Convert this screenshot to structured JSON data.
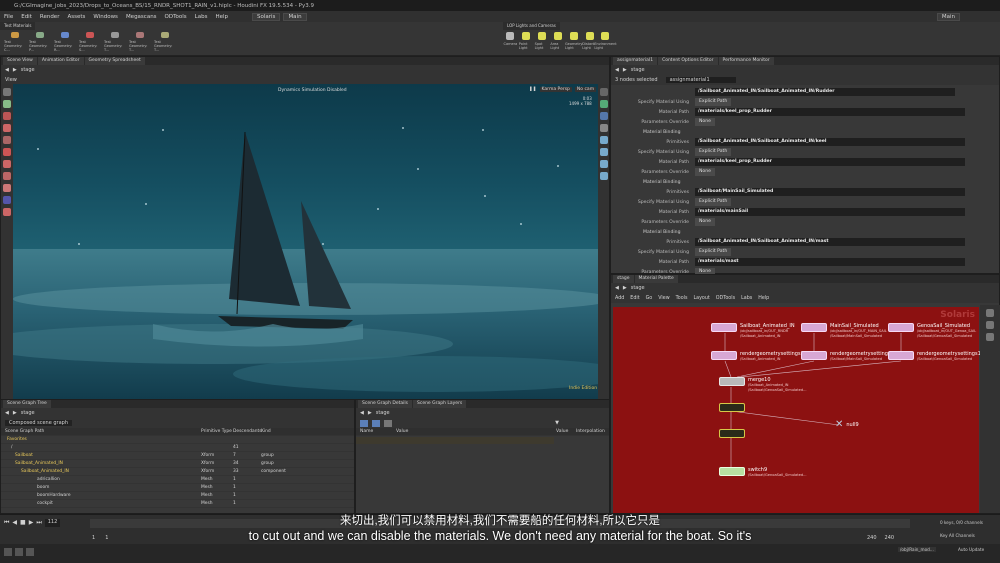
{
  "window": {
    "title": "G:/CGImagine_jobs_2023/Drops_to_Oceans_BS/15_RNDR_SHOT1_RAIN_v1.hiplc - Houdini FX 19.5.534 - Py3.9"
  },
  "menu": {
    "items": [
      "File",
      "Edit",
      "Render",
      "Assets",
      "Windows",
      "Megascans",
      "ODTools",
      "Labs",
      "Help"
    ],
    "desktop": "Solaris",
    "context": "Main"
  },
  "shelf": {
    "left_tab": "Test Materials",
    "tools": [
      "Test Geometry: C...",
      "Test Geometry: P...",
      "Test Geometry: R...",
      "Test Geometry: S...",
      "Test Geometry: T...",
      "Test Geometry: T...",
      "Test Geometry: T..."
    ],
    "right_tab": "LOP Lights and Cameras",
    "right_tools": [
      "Camera",
      "Point Light",
      "Spot Light",
      "Area Light",
      "Geometry Light",
      "Distant Light",
      "Environment Light"
    ]
  },
  "viewer": {
    "tabs": [
      "Scene View",
      "Animation Editor",
      "Geometry Spreadsheet"
    ],
    "path": "stage",
    "label": "View",
    "banner": "Dynamics Simulation Disabled",
    "camera": "Karma Persp",
    "cam_menu": "No cam",
    "stats_line1": "0:03",
    "stats_line2": "1499 x 788",
    "engine": "Indie Edition"
  },
  "params": {
    "tabs": [
      "assignmaterial1",
      "Content Options Editor",
      "Performance Monitor"
    ],
    "nodes_selected": "3 nodes selected",
    "node_name": "assignmaterial1",
    "path_top": "/Sailboat_Animated_IN/Sailboat_Animated_IN/Rudder",
    "rows": [
      {
        "label": "Specify Material Using",
        "value": "Explicit Path",
        "kind": "dd"
      },
      {
        "label": "Material Path",
        "value": "/materials/keel_prop_Rudder",
        "kind": "val"
      },
      {
        "label": "Parameters Override",
        "value": "None",
        "kind": "dd"
      },
      {
        "label": "Material Binding",
        "value": "",
        "kind": "head"
      },
      {
        "label": "Primitives",
        "value": "/Sailboat_Animated_IN/Sailboat_Animated_IN/keel",
        "kind": "val"
      },
      {
        "label": "Specify Material Using",
        "value": "Explicit Path",
        "kind": "dd"
      },
      {
        "label": "Material Path",
        "value": "/materials/keel_prop_Rudder",
        "kind": "val"
      },
      {
        "label": "Parameters Override",
        "value": "None",
        "kind": "dd"
      },
      {
        "label": "Material Binding",
        "value": "",
        "kind": "head"
      },
      {
        "label": "Primitives",
        "value": "/Sailboat/MainSail_Simulated",
        "kind": "val"
      },
      {
        "label": "Specify Material Using",
        "value": "Explicit Path",
        "kind": "dd"
      },
      {
        "label": "Material Path",
        "value": "/materials/mainSail",
        "kind": "val"
      },
      {
        "label": "Parameters Override",
        "value": "None",
        "kind": "dd"
      },
      {
        "label": "Material Binding",
        "value": "",
        "kind": "head"
      },
      {
        "label": "Primitives",
        "value": "/Sailboat_Animated_IN/Sailboat_Animated_IN/mast",
        "kind": "val"
      },
      {
        "label": "Specify Material Using",
        "value": "Explicit Path",
        "kind": "dd"
      },
      {
        "label": "Material Path",
        "value": "/materials/mast",
        "kind": "val"
      },
      {
        "label": "Parameters Override",
        "value": "None",
        "kind": "dd"
      }
    ]
  },
  "network": {
    "tabs": [
      "stage",
      "Material Palette"
    ],
    "path": "stage",
    "menu": [
      "Add",
      "Edit",
      "Go",
      "View",
      "Tools",
      "Layout",
      "ODTools",
      "Labs",
      "Help"
    ],
    "watermark": "Solaris",
    "nodes": [
      {
        "name": "Sailboat_Animated_IN",
        "sub1": "/obj/sailboat_in/OUT_RNDR",
        "sub2": "/Sailboat_Animated_IN",
        "color": "pink"
      },
      {
        "name": "MainSail_Simulated",
        "sub1": "/obj/sailboat_in/OUT_MAIN_SAIL",
        "sub2": "/Sailboat/MainSail_Simulated",
        "color": "pink"
      },
      {
        "name": "GenoaSail_Simulated",
        "sub1": "/obj/sailboat_in/OUT_Genoa_SAIL",
        "sub2": "/Sailboat/GenoaSail_Simulated",
        "color": "pink"
      },
      {
        "name": "rendergeometrysettings16",
        "sub1": "/Sailboat_Animated_IN",
        "sub2": "",
        "color": "pink"
      },
      {
        "name": "rendergeometrysettings18",
        "sub1": "/Sailboat/MainSail_Simulated",
        "sub2": "",
        "color": "pink"
      },
      {
        "name": "rendergeometrysettings17",
        "sub1": "/Sailboat/GenoaSail_Simulated",
        "sub2": "",
        "color": "pink"
      },
      {
        "name": "merge10",
        "sub1": "/Sailboat_Animated_IN",
        "sub2": "/Sailboat/GenoaSail_Simulated...",
        "color": "grey"
      },
      {
        "name": "",
        "sub1": "",
        "sub2": "",
        "color": "yel"
      },
      {
        "name": "",
        "sub1": "",
        "sub2": "",
        "color": "yel"
      },
      {
        "name": "switch9",
        "sub1": "/Sailboat/GenoaSail_Simulated...",
        "sub2": "",
        "color": "grn"
      },
      {
        "name": "null9",
        "sub1": "",
        "sub2": "",
        "color": "null"
      }
    ]
  },
  "scene_graph": {
    "tabs": [
      "Scene Graph Tree"
    ],
    "path": "stage",
    "filter": "Composed scene graph",
    "columns": [
      "Scene Graph Path",
      "Primitive Type",
      "Descendants",
      "Kind"
    ],
    "rows": [
      {
        "name": "Favorites",
        "type": "",
        "desc": "",
        "kind": ""
      },
      {
        "name": "/",
        "type": "",
        "desc": "41",
        "kind": ""
      },
      {
        "name": "Sailboat",
        "type": "Xform",
        "desc": "7",
        "kind": "group"
      },
      {
        "name": "Sailboat_Animated_IN",
        "type": "Xform",
        "desc": "34",
        "kind": "group"
      },
      {
        "name": "Sailboat_Animated_IN",
        "type": "Xform",
        "desc": "33",
        "kind": "component"
      },
      {
        "name": "adricallion",
        "type": "Mesh",
        "desc": "1",
        "kind": ""
      },
      {
        "name": "boom",
        "type": "Mesh",
        "desc": "1",
        "kind": ""
      },
      {
        "name": "boomHardware",
        "type": "Mesh",
        "desc": "1",
        "kind": ""
      },
      {
        "name": "cockpit",
        "type": "Mesh",
        "desc": "1",
        "kind": ""
      },
      {
        "name": "cushions",
        "type": "Mesh",
        "desc": "1",
        "kind": ""
      }
    ]
  },
  "details": {
    "tabs": [
      "Scene Graph Details",
      "Scene Graph Layers"
    ],
    "path": "stage",
    "columns": [
      "Name",
      "Value"
    ],
    "right_cols": [
      "Value",
      "Interpolation"
    ]
  },
  "timeline": {
    "frame": "112",
    "start": "1",
    "start2": "1",
    "end": "240",
    "end2": "240",
    "keys": "0 keys, 0/0 channels",
    "key_all": "Key All Channels",
    "auto_update": "Auto Update",
    "status_path": "/obj/Rain_mod..."
  },
  "subtitles": {
    "zh": "来切出,我们可以禁用材料,我们不需要船的任何材料,所以它只是",
    "en": "to cut out and we can disable the materials. We don't need any material for the boat. So it's"
  }
}
